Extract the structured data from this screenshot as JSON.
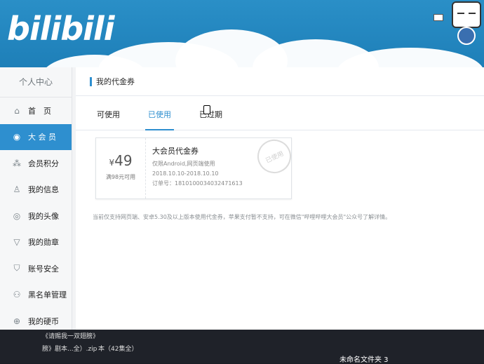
{
  "header": {
    "logo_text": "bilibili"
  },
  "sidebar": {
    "title": "个人中心",
    "items": [
      {
        "label": "首　页",
        "icon": "home-icon"
      },
      {
        "label": "大 会 员",
        "icon": "vip-icon",
        "active": true
      },
      {
        "label": "会员积分",
        "icon": "points-icon"
      },
      {
        "label": "我的信息",
        "icon": "user-info-icon"
      },
      {
        "label": "我的头像",
        "icon": "avatar-icon"
      },
      {
        "label": "我的勋章",
        "icon": "medal-icon"
      },
      {
        "label": "账号安全",
        "icon": "shield-icon"
      },
      {
        "label": "黑名单管理",
        "icon": "blacklist-icon"
      },
      {
        "label": "我的硬币",
        "icon": "coin-icon"
      }
    ]
  },
  "main": {
    "title": "我的代金券",
    "tabs": [
      {
        "label": "可使用"
      },
      {
        "label": "已使用",
        "active": true
      },
      {
        "label": "已过期"
      }
    ],
    "coupon": {
      "currency": "¥",
      "amount": "49",
      "condition": "满98元可用",
      "name": "大会员代金券",
      "scope": "仅限Android,网页端使用",
      "validity": "2018.10.10-2018.10.10",
      "order": "订单号：1810100034032471613",
      "stamp": "已使用"
    },
    "notice": "当前仅支持网页端、安卓5.30及以上版本使用代金券，苹果支付暂不支持，可在微信\"哔哩哔哩大会员\"公众号了解详情。"
  },
  "taskbar": {
    "file1_line1": "《请赐我一双翅膀》",
    "file1_line2": "膀》剧本...全）.zip",
    "file2": "本（42集全）",
    "folder": "未命名文件夹 3"
  },
  "colors": {
    "accent": "#2e8fcf",
    "banner": "#1e7fb8"
  }
}
